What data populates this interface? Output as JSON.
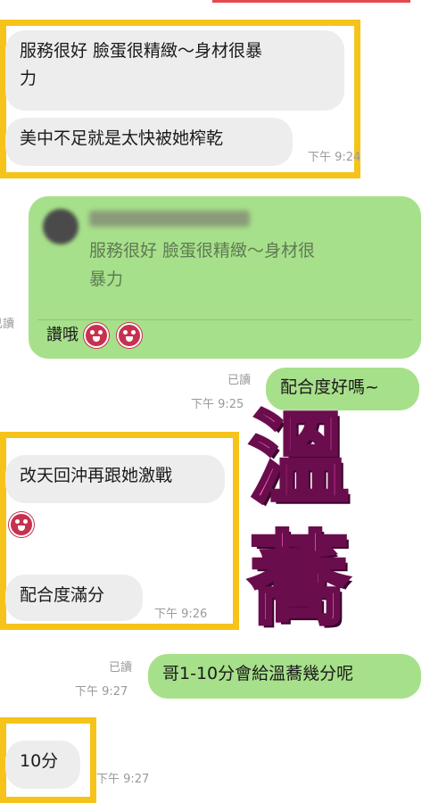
{
  "messages": {
    "m1": {
      "line1": "服務很好 臉蛋很精緻～身材很暴",
      "line2": "力"
    },
    "m2": {
      "text": "美中不足就是太快被她榨乾",
      "time": "下午 9:24"
    },
    "reply": {
      "quote_line1": "服務很好 臉蛋很精緻～身材很",
      "quote_line2": "暴力",
      "text": "讚哦",
      "left_read_fragment": "已讀"
    },
    "m3": {
      "text": "配合度好嗎~",
      "read": "已讀",
      "time": "下午 9:25"
    },
    "m4": {
      "text": "改天回沖再跟她激戰"
    },
    "m5": {
      "text": "配合度滿分",
      "time": "下午 9:26"
    },
    "m6": {
      "text": "哥1-10分會給溫蕎幾分呢",
      "read": "已讀",
      "time": "下午 9:27"
    },
    "m7": {
      "text": "10分",
      "time": "下午 9:27"
    }
  },
  "stamp": {
    "char1": "溫",
    "char2": "蕎"
  },
  "colors": {
    "highlight": "#f6c31a",
    "outgoing": "#a7e08a",
    "incoming": "#ededed",
    "stamp": "#ff5fc2"
  }
}
